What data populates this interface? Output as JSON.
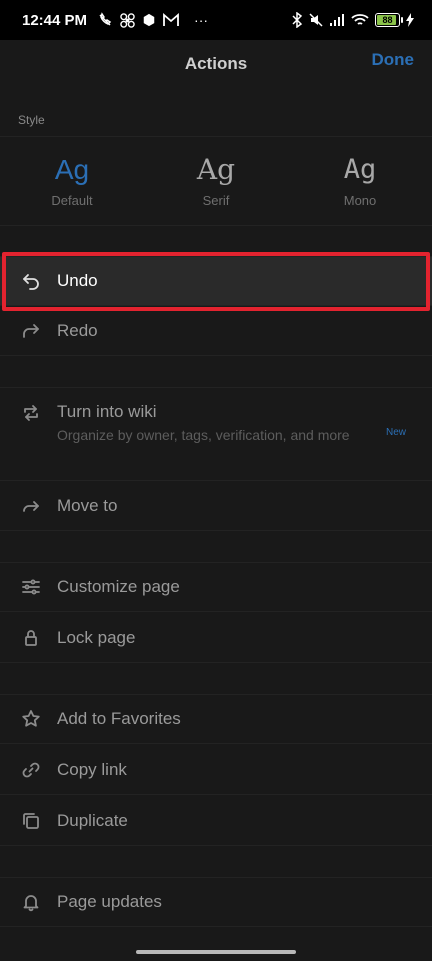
{
  "status_bar": {
    "time": "12:44 PM",
    "notification_icons": [
      "phone-muted-icon",
      "fan-icon",
      "cube-icon",
      "gmail-icon"
    ],
    "more": "···",
    "battery": "88"
  },
  "header": {
    "title": "Actions",
    "done_label": "Done"
  },
  "style": {
    "label": "Style",
    "options": [
      {
        "glyph": "Ag",
        "name": "Default",
        "selected": true
      },
      {
        "glyph": "Ag",
        "name": "Serif",
        "selected": false
      },
      {
        "glyph": "Ag",
        "name": "Mono",
        "selected": false
      }
    ]
  },
  "actions": {
    "undo": "Undo",
    "redo": "Redo",
    "turn_into_wiki": "Turn into wiki",
    "turn_into_wiki_desc": "Organize by owner, tags, verification, and more",
    "new_badge": "New",
    "move_to": "Move to",
    "customize_page": "Customize page",
    "lock_page": "Lock page",
    "add_to_favorites": "Add to Favorites",
    "copy_link": "Copy link",
    "duplicate": "Duplicate",
    "page_updates": "Page updates"
  },
  "colors": {
    "accent": "#2b6fb5",
    "highlight": "#e3232f",
    "background": "#191919"
  }
}
